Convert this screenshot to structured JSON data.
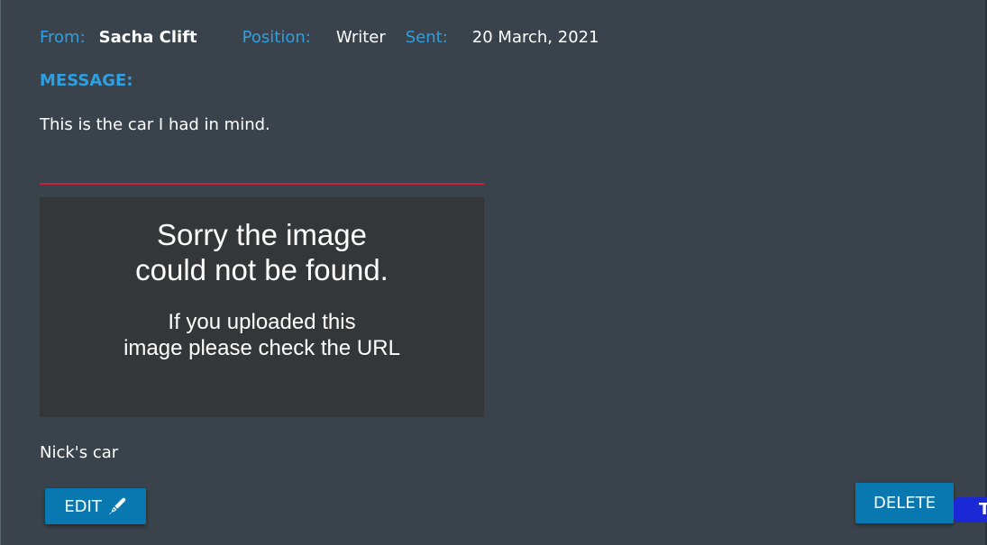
{
  "header": {
    "from_label": "From:",
    "from_value": "Sacha Clift",
    "position_label": "Position:",
    "position_value": "Writer",
    "sent_label": "Sent:",
    "sent_value": "20 March, 2021"
  },
  "message": {
    "label": "MESSAGE:",
    "body": "This is the car I had in mind."
  },
  "image_placeholder": {
    "line1": "Sorry the image",
    "line2": "could not be found.",
    "line3": "If you uploaded this",
    "line4": "image please check the URL"
  },
  "caption": "Nick's car",
  "actions": {
    "edit_label": "EDIT",
    "edit_icon": "pen-icon",
    "delete_label": "DELETE"
  },
  "corner_tag": {
    "text": "T"
  },
  "colors": {
    "background": "#3a434b",
    "label": "#2e9fe0",
    "divider": "#c8203c",
    "button": "#0a78b0",
    "corner_tag": "#1a28d6"
  }
}
